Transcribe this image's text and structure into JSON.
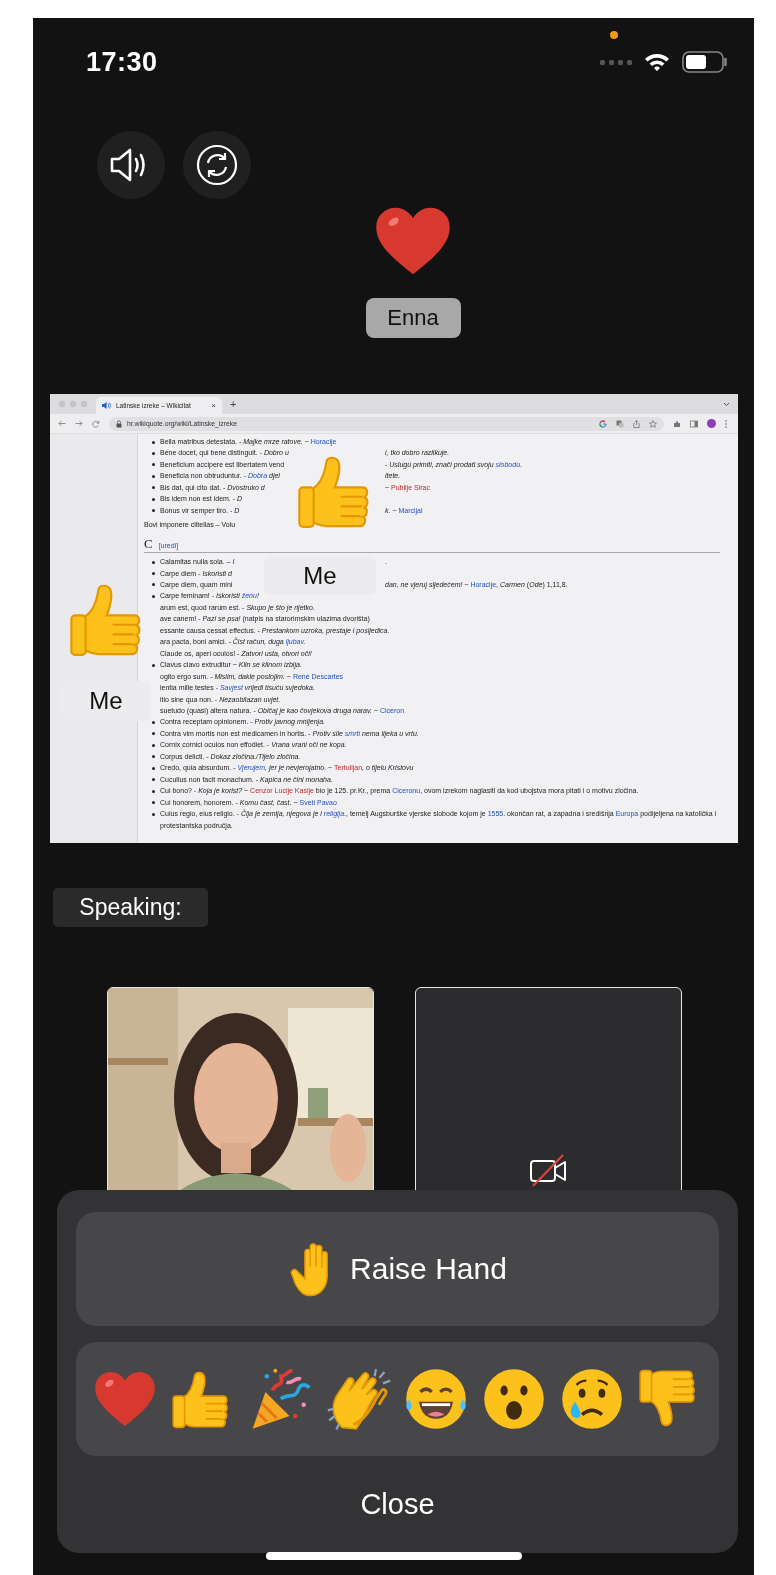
{
  "status_bar": {
    "time": "17:30"
  },
  "controls": [
    {
      "kind": "speaker"
    },
    {
      "kind": "switch_camera"
    }
  ],
  "reaction_popup": {
    "kind": "heart",
    "name": "Enna"
  },
  "shared_screen": {
    "browser": {
      "tab_title": "Latinske izreke – Wikicitat",
      "tab_close": "×",
      "new_tab": "+",
      "url": "hr.wikiquote.org/wiki/Latinske_izreke"
    },
    "blocks": [
      {
        "kind": "item",
        "covered_start": false,
        "segments": [
          [
            "Bella matribus detestata. - *Majke mrze ratove.* ~ ",
            {
              "text": "Horacije",
              "kind": "link"
            }
          ]
        ]
      },
      {
        "kind": "item",
        "covered_start": false,
        "segments": [
          [
            "Bene docet, qui bene distinguit. - *Dobro u*"
          ],
          [
            "*i, tko dobro razlikuje.*"
          ]
        ]
      },
      {
        "kind": "item",
        "covered_start": false,
        "segments": [
          [
            "Beneficium accipere est libertatem vend"
          ],
          [
            "- *Uslugu primiti, znači prodati svoju* ",
            {
              "text": "*slobodu*",
              "kind": "link"
            },
            "."
          ]
        ]
      },
      {
        "kind": "item",
        "covered_start": false,
        "segments": [
          [
            "Beneficia non obtruduntur. - ",
            {
              "text": "*Dobra*",
              "kind": "link"
            },
            " *djel*"
          ],
          [
            "*itete.*"
          ]
        ]
      },
      {
        "kind": "item",
        "covered_start": false,
        "segments": [
          [
            "Bis dat, qui cito dat. - *Dvostruko d*"
          ],
          [
            "~ ",
            {
              "text": "Publije Sirac",
              "kind": "redlink"
            }
          ]
        ]
      },
      {
        "kind": "item",
        "covered_start": false,
        "segments": [
          [
            "Bis idem non est idem. - *D*"
          ]
        ]
      },
      {
        "kind": "item",
        "covered_start": false,
        "segments": [
          [
            "Bonus vir semper tiro. - *D*"
          ],
          [
            "*k.* ~ ",
            {
              "text": "Marcijal",
              "kind": "link"
            }
          ]
        ]
      },
      {
        "kind": "paragraph",
        "segments": [
          [
            "Bovi imponere clitellas – Volu"
          ]
        ]
      },
      {
        "kind": "heading",
        "letter": "C",
        "edit": "[uredi]"
      },
      {
        "kind": "item",
        "covered_start": false,
        "segments": [
          [
            "Calamitas nulla sola. – *I*"
          ],
          [
            "."
          ]
        ]
      },
      {
        "kind": "item",
        "covered_start": false,
        "segments": [
          [
            "Carpe diem - *Iskoristi d*"
          ]
        ]
      },
      {
        "kind": "item",
        "covered_start": false,
        "segments": [
          [
            "Carpe diem, quam mini"
          ],
          [
            "*dan, ne vjeruj sljedećem!* ~ ",
            {
              "text": "Horacije",
              "kind": "link"
            },
            ", *Carmen* (*Ode*) 1,11,8."
          ]
        ]
      },
      {
        "kind": "item",
        "covered_start": false,
        "segments": [
          [
            "Carpe feminam! - *Iskoristi* ",
            {
              "text": "*ženu*",
              "kind": "link"
            },
            "*!*"
          ]
        ]
      },
      {
        "kind": "item",
        "covered_start": true,
        "segments": [
          [
            "arum est, quod rarum est. - *Skupo je što je rijetko.*"
          ]
        ]
      },
      {
        "kind": "item",
        "covered_start": true,
        "segments": [
          [
            "ave canem! - *Pazi se psa!* (natpis na starorimskim ulazima dvorišta)"
          ]
        ]
      },
      {
        "kind": "item",
        "covered_start": true,
        "segments": [
          [
            "essante causa cessat effectus. - *Prestankom uzroka, prestaje i posljedica.*"
          ]
        ]
      },
      {
        "kind": "item",
        "covered_start": true,
        "segments": [
          [
            "ara pacta, boni amici. - *Čist račun, duga* ",
            {
              "text": "*ljubav*",
              "kind": "link"
            },
            "*.*"
          ]
        ]
      },
      {
        "kind": "item",
        "covered_start": true,
        "segments": [
          [
            "Claude os, aperi oculos! - *Zatvori usta, otvori oči!*"
          ]
        ]
      },
      {
        "kind": "item",
        "covered_start": false,
        "segments": [
          [
            "Clavus clavo extruditur ~ *Klin se klinom izbija.*"
          ]
        ]
      },
      {
        "kind": "item",
        "covered_start": true,
        "segments": [
          [
            "ogito ergo sum. - *Mislim, dakle postojim.* ~ ",
            {
              "text": "René Descartes",
              "kind": "link"
            }
          ]
        ]
      },
      {
        "kind": "item",
        "covered_start": true,
        "segments": [
          [
            "ientia mille testes - ",
            {
              "text": "*Savjest*",
              "kind": "link"
            },
            " *vrijedi tisuću svjedoka.*"
          ]
        ]
      },
      {
        "kind": "item",
        "covered_start": true,
        "segments": [
          [
            "itio sine qua non. - *Nezaobilazan uvjet.*"
          ]
        ]
      },
      {
        "kind": "item",
        "covered_start": true,
        "segments": [
          [
            "suetudo (quasi) altera natura. - *Običaj je kao čovjekova druga narav.* ~ ",
            {
              "text": "Ciceron",
              "kind": "link"
            }
          ]
        ]
      },
      {
        "kind": "item",
        "covered_start": false,
        "segments": [
          [
            "Contra receptam opinionem. - *Protiv javnog mnijenja.*"
          ]
        ]
      },
      {
        "kind": "item",
        "covered_start": false,
        "segments": [
          [
            "Contra vim mortis non est medicamen in hortis. - *Protiv sile* ",
            {
              "text": "*smrti*",
              "kind": "link"
            },
            " *nema lijeka u vrtu.*"
          ]
        ]
      },
      {
        "kind": "item",
        "covered_start": false,
        "segments": [
          [
            "Cornix cornici oculos non effodiet. - *Vrana vrani oči ne kopa.*"
          ]
        ]
      },
      {
        "kind": "item",
        "covered_start": false,
        "segments": [
          [
            "Corpus delicti. - *Dokaz zločina./Tijelo zločina.*"
          ]
        ]
      },
      {
        "kind": "item",
        "covered_start": false,
        "segments": [
          [
            "Credo, quia absurdum. - ",
            {
              "text": "*Vjerujem*",
              "kind": "link"
            },
            "*, jer je nevjerojatno.* ~ ",
            {
              "text": "Tertulijan",
              "kind": "redlink"
            },
            "*, o tijelu Kristovu*"
          ]
        ]
      },
      {
        "kind": "item",
        "covered_start": false,
        "segments": [
          [
            "Cucullus non facit monachum. - *Kapica ne čini monaha.*"
          ]
        ]
      },
      {
        "kind": "item",
        "covered_start": false,
        "segments": [
          [
            "Cui bono? - *Koja je korist?* ~ ",
            {
              "text": "Cenzor Lucije Kasije",
              "kind": "redlink"
            },
            " bio je 125. pr.Kr., prema ",
            {
              "text": "Ciceronu",
              "kind": "link"
            },
            ", ovom izrekom naglasiti da kod ubojstva mora pitati i o motivu zločina."
          ]
        ]
      },
      {
        "kind": "item",
        "covered_start": false,
        "segments": [
          [
            "Cui honorem, honorem. - *Komu čast, čast.* ~ ",
            {
              "text": "Sveti Pavao",
              "kind": "link"
            }
          ]
        ]
      },
      {
        "kind": "item",
        "covered_start": false,
        "segments": [
          [
            "Cuius regio, eius religio. - *Čija je zemlja, njegova je i* ",
            {
              "text": "*religija*",
              "kind": "link"
            },
            "., temelj Augsburške vjerske slobode kojom je ",
            {
              "text": "1555",
              "kind": "link"
            },
            ". okončan rat, a zapadna i središnja ",
            {
              "text": "Europa",
              "kind": "link"
            },
            " podijeljena na katolička i protestantska područja."
          ]
        ]
      }
    ],
    "overlays": [
      {
        "kind": "thumbs_up"
      },
      {
        "kind": "name_tag",
        "text": "Me"
      },
      {
        "kind": "thumbs_up"
      },
      {
        "kind": "name_tag",
        "text": "Me"
      }
    ]
  },
  "speaking_label": "Speaking:",
  "video_tiles": [
    {
      "kind": "video"
    },
    {
      "kind": "camera_off"
    }
  ],
  "sheet": {
    "raise_hand": "Raise Hand",
    "reactions": [
      {
        "kind": "heart"
      },
      {
        "kind": "thumbs_up"
      },
      {
        "kind": "party"
      },
      {
        "kind": "clap"
      },
      {
        "kind": "laugh"
      },
      {
        "kind": "wow"
      },
      {
        "kind": "sad"
      },
      {
        "kind": "thumbs_down"
      }
    ],
    "close": "Close"
  }
}
